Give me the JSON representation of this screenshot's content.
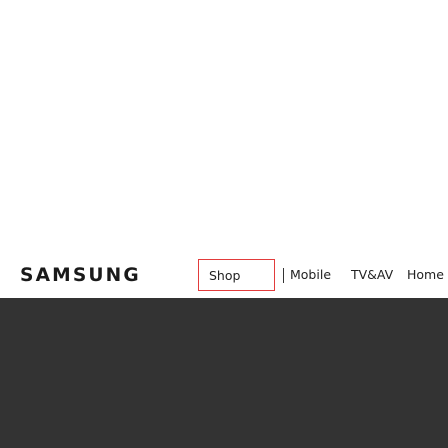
{
  "brand": {
    "logo_text": "SAMSUNG"
  },
  "nav": {
    "items": [
      {
        "label": "Shop"
      },
      {
        "label": "Mobile"
      },
      {
        "label": "TV&AV"
      },
      {
        "label": "Home Appl"
      }
    ],
    "highlight_color": "#e23b3b"
  },
  "colors": {
    "hero_background": "#333333"
  }
}
